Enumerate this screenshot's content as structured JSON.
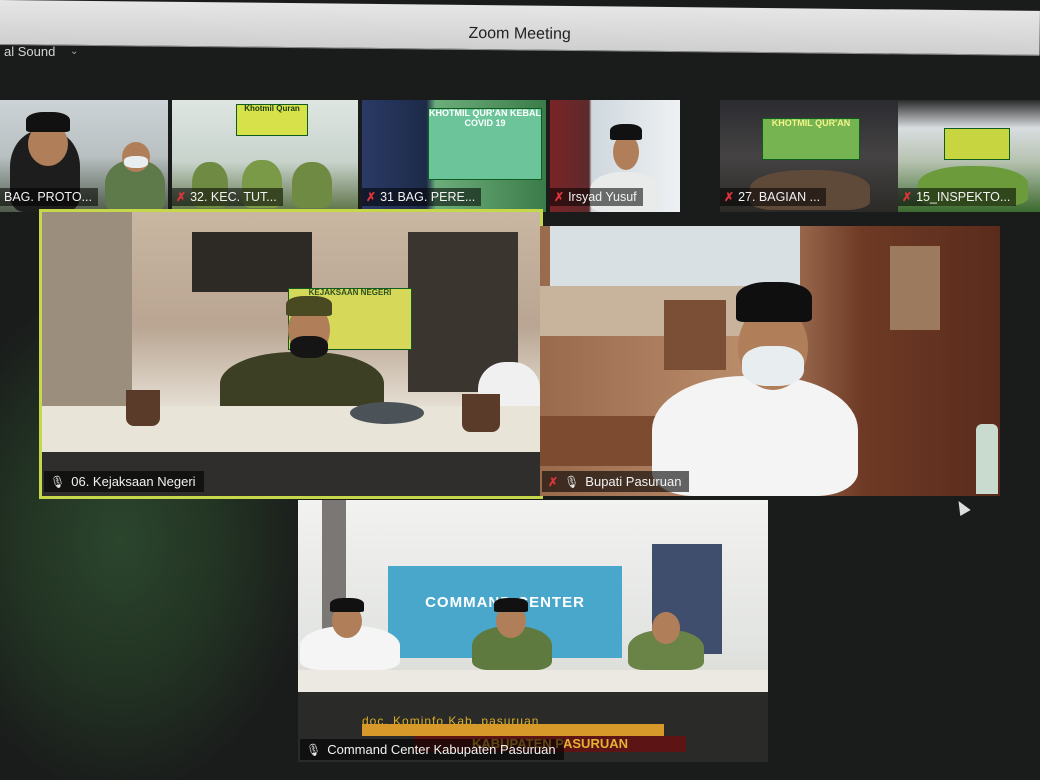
{
  "window": {
    "title": "Zoom Meeting"
  },
  "audio": {
    "label": "al Sound"
  },
  "thumbnails": [
    {
      "name": "BAG. PROTO...",
      "muted": false
    },
    {
      "name": "32. KEC. TUT...",
      "muted": true,
      "banner": "Khotmil Quran"
    },
    {
      "name": "31 BAG. PERE...",
      "muted": true,
      "banner": "KHOTMIL QUR'AN KEBAL COVID 19"
    },
    {
      "name": "Irsyad Yusuf",
      "muted": true
    },
    {
      "name": "27. BAGIAN ...",
      "muted": true,
      "banner": "KHOTMIL QUR'AN"
    },
    {
      "name": "15_INSPEKTO...",
      "muted": true
    }
  ],
  "tiles": [
    {
      "name": "06. Kejaksaan Negeri",
      "muted": false,
      "active": true,
      "banner": "KEJAKSAAN NEGERI"
    },
    {
      "name": "Bupati Pasuruan",
      "muted": true,
      "active": false
    },
    {
      "name": "Command Center Kabupaten Pasuruan",
      "muted": false,
      "active": false,
      "wall_sign": "COMMAND CENTER",
      "overlay_top": "doc. Kominfo Kab. pasuruan",
      "overlay_bottom": "KABUPATEN PASURUAN"
    }
  ],
  "colors": {
    "active_border": "#c6d84a",
    "muted_icon": "#e0353c"
  }
}
